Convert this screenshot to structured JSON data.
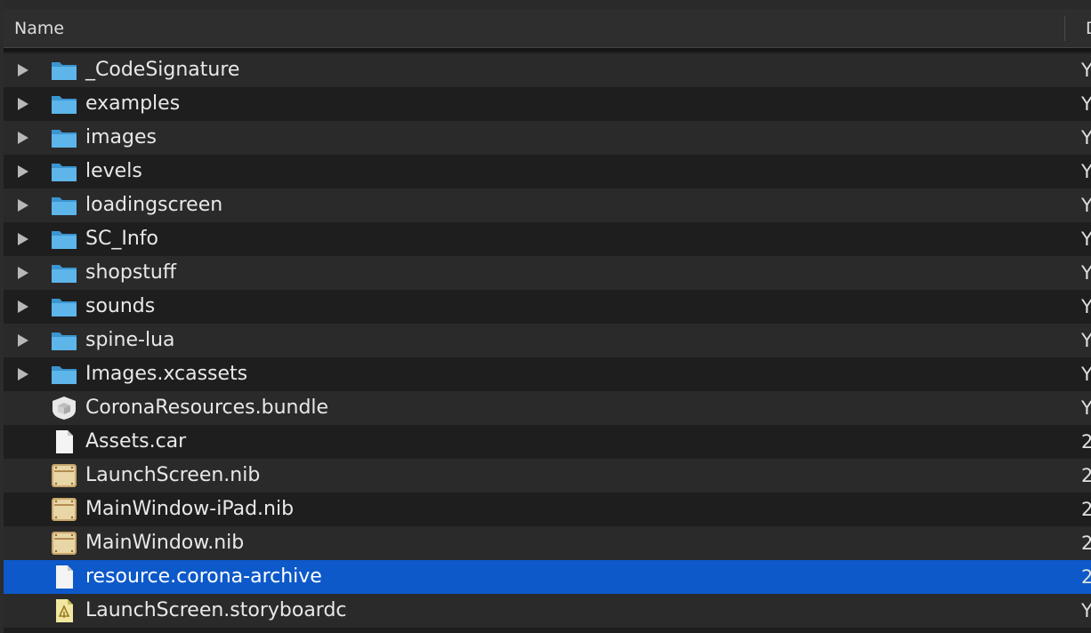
{
  "header": {
    "name_label": "Name",
    "next_label": "D"
  },
  "rows": [
    {
      "name": "_CodeSignature",
      "icon": "folder-icon",
      "expandable": true,
      "trail": "Y"
    },
    {
      "name": "examples",
      "icon": "folder-icon",
      "expandable": true,
      "trail": "Y"
    },
    {
      "name": "images",
      "icon": "folder-icon",
      "expandable": true,
      "trail": "Y"
    },
    {
      "name": "levels",
      "icon": "folder-icon",
      "expandable": true,
      "trail": "Y"
    },
    {
      "name": "loadingscreen",
      "icon": "folder-icon",
      "expandable": true,
      "trail": "Y"
    },
    {
      "name": "SC_Info",
      "icon": "folder-icon",
      "expandable": true,
      "trail": "Y"
    },
    {
      "name": "shopstuff",
      "icon": "folder-icon",
      "expandable": true,
      "trail": "Y"
    },
    {
      "name": "sounds",
      "icon": "folder-icon",
      "expandable": true,
      "trail": "Y"
    },
    {
      "name": "spine-lua",
      "icon": "folder-icon",
      "expandable": true,
      "trail": "Y"
    },
    {
      "name": "Images.xcassets",
      "icon": "folder-icon",
      "expandable": true,
      "trail": "Y"
    },
    {
      "name": "CoronaResources.bundle",
      "icon": "bundle-icon",
      "expandable": false,
      "trail": "Y"
    },
    {
      "name": "Assets.car",
      "icon": "document-icon",
      "expandable": false,
      "trail": "2"
    },
    {
      "name": "LaunchScreen.nib",
      "icon": "nib-icon",
      "expandable": false,
      "trail": "2"
    },
    {
      "name": "MainWindow-iPad.nib",
      "icon": "nib-icon",
      "expandable": false,
      "trail": "2"
    },
    {
      "name": "MainWindow.nib",
      "icon": "nib-icon",
      "expandable": false,
      "trail": "2"
    },
    {
      "name": "resource.corona-archive",
      "icon": "document-icon",
      "expandable": false,
      "trail": "2",
      "selected": true
    },
    {
      "name": "LaunchScreen.storyboardc",
      "icon": "storyboard-icon",
      "expandable": false,
      "trail": "Y"
    }
  ],
  "colors": {
    "selection": "#0d59c9",
    "folder": "#4aa8e0",
    "row_alt": "#2a2a2a",
    "row_base": "#1e1e1e"
  }
}
